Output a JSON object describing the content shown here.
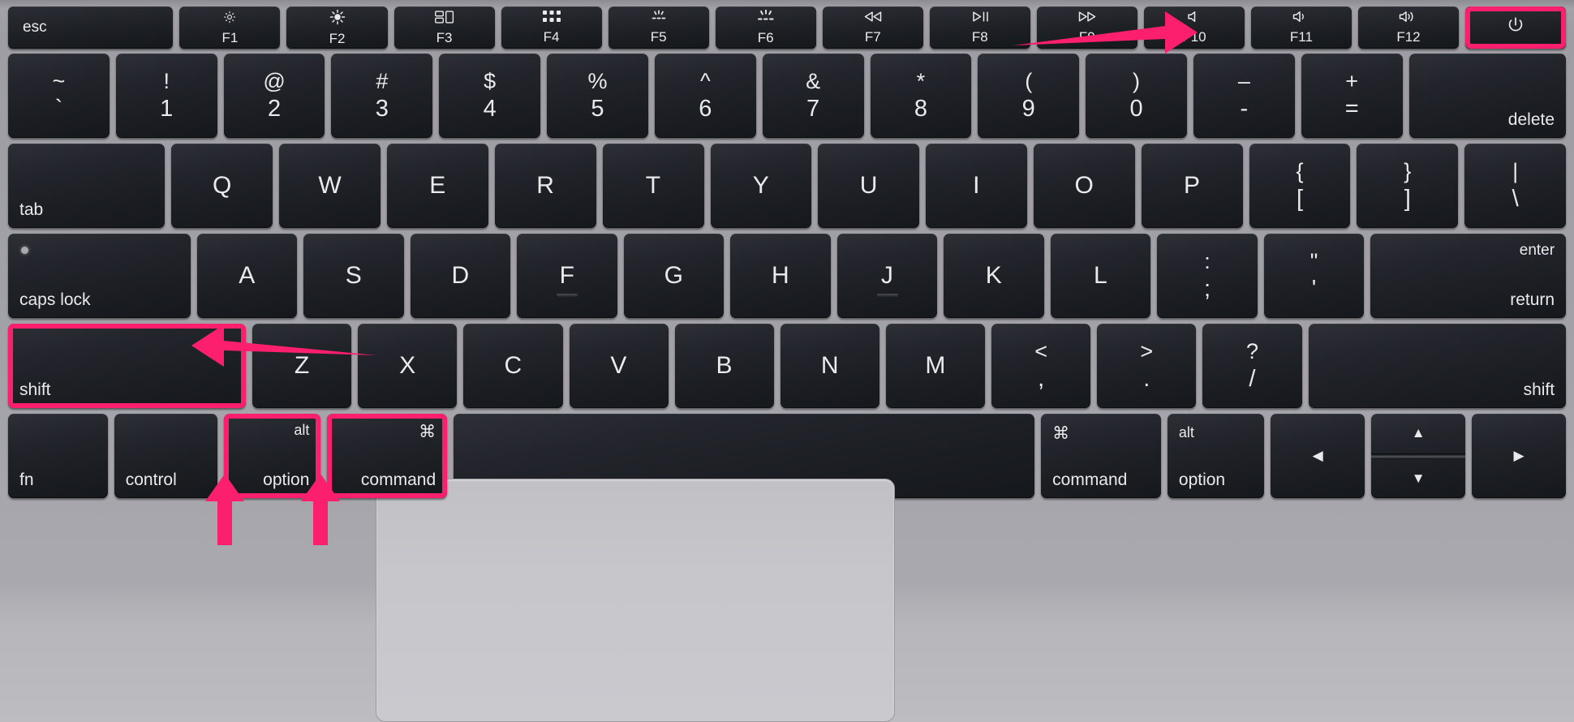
{
  "device": {
    "name": "MacBook keyboard",
    "chassis_color": "#a2a2a8",
    "key_color": "#1d2025",
    "highlight_color": "#fb1f6e"
  },
  "rows": {
    "function_row": [
      {
        "id": "esc",
        "label": "esc",
        "glyph": "",
        "fn": "",
        "width": 2.05,
        "style": "esc"
      },
      {
        "id": "f1",
        "label": "",
        "glyph": "brightness-low-icon",
        "fn": "F1",
        "width": 1.25,
        "style": "fn"
      },
      {
        "id": "f2",
        "label": "",
        "glyph": "brightness-high-icon",
        "fn": "F2",
        "width": 1.25,
        "style": "fn"
      },
      {
        "id": "f3",
        "label": "",
        "glyph": "mission-control-icon",
        "fn": "F3",
        "width": 1.25,
        "style": "fn"
      },
      {
        "id": "f4",
        "label": "",
        "glyph": "launchpad-icon",
        "fn": "F4",
        "width": 1.25,
        "style": "fn"
      },
      {
        "id": "f5",
        "label": "",
        "glyph": "keyboard-backlight-down-icon",
        "fn": "F5",
        "width": 1.25,
        "style": "fn"
      },
      {
        "id": "f6",
        "label": "",
        "glyph": "keyboard-backlight-up-icon",
        "fn": "F6",
        "width": 1.25,
        "style": "fn"
      },
      {
        "id": "f7",
        "label": "",
        "glyph": "rewind-icon",
        "fn": "F7",
        "width": 1.25,
        "style": "fn"
      },
      {
        "id": "f8",
        "label": "",
        "glyph": "play-pause-icon",
        "fn": "F8",
        "width": 1.25,
        "style": "fn"
      },
      {
        "id": "f9",
        "label": "",
        "glyph": "fast-forward-icon",
        "fn": "F9",
        "width": 1.25,
        "style": "fn"
      },
      {
        "id": "f10",
        "label": "",
        "glyph": "mute-icon",
        "fn": "F10",
        "width": 1.25,
        "style": "fn"
      },
      {
        "id": "f11",
        "label": "",
        "glyph": "volume-down-icon",
        "fn": "F11",
        "width": 1.25,
        "style": "fn"
      },
      {
        "id": "f12",
        "label": "",
        "glyph": "volume-up-icon",
        "fn": "F12",
        "width": 1.25,
        "style": "fn"
      },
      {
        "id": "power",
        "label": "",
        "glyph": "power-icon",
        "fn": "",
        "width": 1.25,
        "style": "power",
        "highlighted": true
      }
    ],
    "number_row": [
      {
        "id": "backtick",
        "top": "~",
        "bottom": "`",
        "width": 1.0
      },
      {
        "id": "1",
        "top": "!",
        "bottom": "1",
        "width": 1.0
      },
      {
        "id": "2",
        "top": "@",
        "bottom": "2",
        "width": 1.0
      },
      {
        "id": "3",
        "top": "#",
        "bottom": "3",
        "width": 1.0
      },
      {
        "id": "4",
        "top": "$",
        "bottom": "4",
        "width": 1.0
      },
      {
        "id": "5",
        "top": "%",
        "bottom": "5",
        "width": 1.0
      },
      {
        "id": "6",
        "top": "^",
        "bottom": "6",
        "width": 1.0
      },
      {
        "id": "7",
        "top": "&",
        "bottom": "7",
        "width": 1.0
      },
      {
        "id": "8",
        "top": "*",
        "bottom": "8",
        "width": 1.0
      },
      {
        "id": "9",
        "top": "(",
        "bottom": "9",
        "width": 1.0
      },
      {
        "id": "0",
        "top": ")",
        "bottom": "0",
        "width": 1.0
      },
      {
        "id": "minus",
        "top": "–",
        "bottom": "-",
        "width": 1.0
      },
      {
        "id": "equal",
        "top": "+",
        "bottom": "=",
        "width": 1.0
      },
      {
        "id": "delete",
        "label": "delete",
        "align": "bottom-right",
        "width": 1.55
      }
    ],
    "qwerty_row": [
      {
        "id": "tab",
        "label": "tab",
        "align": "bottom-left",
        "width": 1.55
      },
      {
        "id": "q",
        "label": "Q",
        "width": 1.0
      },
      {
        "id": "w",
        "label": "W",
        "width": 1.0
      },
      {
        "id": "e",
        "label": "E",
        "width": 1.0
      },
      {
        "id": "r",
        "label": "R",
        "width": 1.0
      },
      {
        "id": "t",
        "label": "T",
        "width": 1.0
      },
      {
        "id": "y",
        "label": "Y",
        "width": 1.0
      },
      {
        "id": "u",
        "label": "U",
        "width": 1.0
      },
      {
        "id": "i",
        "label": "I",
        "width": 1.0
      },
      {
        "id": "o",
        "label": "O",
        "width": 1.0
      },
      {
        "id": "p",
        "label": "P",
        "width": 1.0
      },
      {
        "id": "bracket-left",
        "top": "{",
        "bottom": "[",
        "width": 1.0
      },
      {
        "id": "bracket-right",
        "top": "}",
        "bottom": "]",
        "width": 1.0
      },
      {
        "id": "backslash",
        "top": "|",
        "bottom": "\\",
        "width": 1.0
      }
    ],
    "home_row": [
      {
        "id": "caps-lock",
        "label": "caps lock",
        "align": "bottom-left",
        "width": 1.82,
        "led": true
      },
      {
        "id": "a",
        "label": "A",
        "width": 1.0
      },
      {
        "id": "s",
        "label": "S",
        "width": 1.0
      },
      {
        "id": "d",
        "label": "D",
        "width": 1.0
      },
      {
        "id": "f",
        "label": "F",
        "width": 1.0,
        "homing": true
      },
      {
        "id": "g",
        "label": "G",
        "width": 1.0
      },
      {
        "id": "h",
        "label": "H",
        "width": 1.0
      },
      {
        "id": "j",
        "label": "J",
        "width": 1.0,
        "homing": true
      },
      {
        "id": "k",
        "label": "K",
        "width": 1.0
      },
      {
        "id": "l",
        "label": "L",
        "width": 1.0
      },
      {
        "id": "semicolon",
        "top": ":",
        "bottom": ";",
        "width": 1.0
      },
      {
        "id": "quote",
        "top": "\"",
        "bottom": "'",
        "width": 1.0
      },
      {
        "id": "return",
        "label": "enter",
        "sublabel": "return",
        "align": "enter",
        "width": 1.95
      }
    ],
    "shift_row": [
      {
        "id": "shift-left",
        "label": "shift",
        "align": "bottom-left",
        "width": 2.4,
        "highlighted": true
      },
      {
        "id": "z",
        "label": "Z",
        "width": 1.0
      },
      {
        "id": "x",
        "label": "X",
        "width": 1.0
      },
      {
        "id": "c",
        "label": "C",
        "width": 1.0
      },
      {
        "id": "v",
        "label": "V",
        "width": 1.0
      },
      {
        "id": "b",
        "label": "B",
        "width": 1.0
      },
      {
        "id": "n",
        "label": "N",
        "width": 1.0
      },
      {
        "id": "m",
        "label": "M",
        "width": 1.0
      },
      {
        "id": "comma",
        "top": "<",
        "bottom": ",",
        "width": 1.0
      },
      {
        "id": "period",
        "top": ">",
        "bottom": ".",
        "width": 1.0
      },
      {
        "id": "slash",
        "top": "?",
        "bottom": "/",
        "width": 1.0
      },
      {
        "id": "shift-right",
        "label": "shift",
        "align": "bottom-right",
        "width": 2.6
      }
    ],
    "modifier_row": [
      {
        "id": "fn",
        "label": "fn",
        "align": "bottom-left",
        "width": 1.08
      },
      {
        "id": "control",
        "label": "control",
        "align": "bottom-left",
        "width": 1.12
      },
      {
        "id": "option-left",
        "label": "option",
        "corner": "alt",
        "align": "bottom-left",
        "corner_pos": "top-right",
        "width": 1.05,
        "highlighted": true
      },
      {
        "id": "command-left",
        "label": "command",
        "corner": "⌘",
        "align": "bottom-left",
        "corner_pos": "top-right",
        "width": 1.3,
        "highlighted": true
      },
      {
        "id": "space",
        "label": "",
        "width": 6.3
      },
      {
        "id": "command-right",
        "label": "command",
        "corner": "⌘",
        "align": "bottom-left",
        "corner_pos": "top-left",
        "width": 1.3
      },
      {
        "id": "option-right",
        "label": "option",
        "corner": "alt",
        "align": "bottom-left",
        "corner_pos": "top-left",
        "width": 1.05
      },
      {
        "id": "arrow-left",
        "label": "◀",
        "align": "arrow-mid",
        "width": 1.02
      },
      {
        "id": "arrow-updown",
        "up": "▲",
        "down": "▼",
        "align": "split",
        "width": 1.02
      },
      {
        "id": "arrow-right",
        "label": "▶",
        "align": "arrow-mid",
        "width": 1.02
      }
    ]
  },
  "annotations": [
    {
      "id": "arrow-to-power",
      "type": "arrow",
      "direction": "right",
      "target": "power-key",
      "color": "#fb1f6e"
    },
    {
      "id": "arrow-to-shift",
      "type": "arrow",
      "direction": "left",
      "target": "shift-left-key",
      "color": "#fb1f6e"
    },
    {
      "id": "arrow-to-option",
      "type": "arrow",
      "direction": "up",
      "target": "option-left-key",
      "color": "#fb1f6e"
    },
    {
      "id": "arrow-to-command",
      "type": "arrow",
      "direction": "up",
      "target": "command-left-key",
      "color": "#fb1f6e"
    }
  ],
  "highlight_boxes": [
    {
      "id": "box-power",
      "target": "power-key"
    },
    {
      "id": "box-shift",
      "target": "shift-left-key"
    },
    {
      "id": "box-option",
      "target": "option-left-key"
    },
    {
      "id": "box-command",
      "target": "command-left-key"
    }
  ]
}
